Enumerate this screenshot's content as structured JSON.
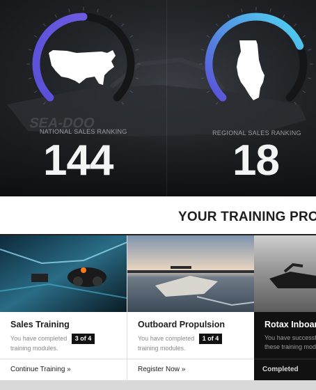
{
  "hero": {
    "national": {
      "label": "NATIONAL SALES RANKING",
      "value": "144",
      "progress": 0.5,
      "shape": "usa-map-icon"
    },
    "regional": {
      "label": "REGIONAL SALES RANKING",
      "value": "18",
      "progress": 0.75,
      "shape": "illinois-map-icon"
    },
    "gauge_color_start": "#5a4fd8",
    "gauge_color_end": "#4fd6f0"
  },
  "banner": {
    "title": "YOUR TRAINING PROGRE"
  },
  "cards": [
    {
      "title": "Sales Training",
      "desc_pre": "You have completed",
      "badge": "3 of 4",
      "desc_post": "training modules.",
      "action": "Continue Training »"
    },
    {
      "title": "Outboard Propulsion",
      "desc_pre": "You have completed",
      "badge": "1 of 4",
      "desc_post": "training modules.",
      "action": "Register Now »"
    },
    {
      "title": "Rotax Inboard",
      "desc_pre": "You have successfu",
      "badge": "",
      "desc_post": "these training mod",
      "action": "Completed"
    }
  ]
}
